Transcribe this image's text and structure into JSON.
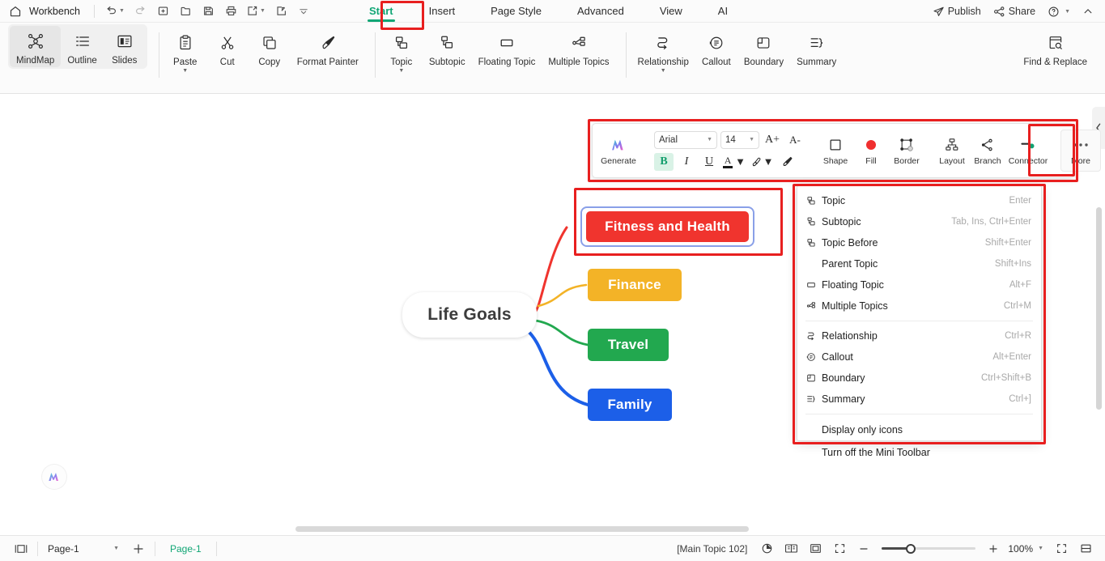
{
  "app": {
    "workbench_label": "Workbench",
    "accent_green": "#11a675",
    "annotation_red": "#e81f1f"
  },
  "quick_access": [
    {
      "name": "undo",
      "icon": "undo-icon",
      "caret": true
    },
    {
      "name": "redo",
      "icon": "redo-icon",
      "caret": false
    },
    {
      "name": "new",
      "icon": "new-file-icon",
      "caret": false
    },
    {
      "name": "open",
      "icon": "open-folder-icon",
      "caret": false
    },
    {
      "name": "save",
      "icon": "save-icon",
      "caret": false
    },
    {
      "name": "print",
      "icon": "print-icon",
      "caret": false
    },
    {
      "name": "export",
      "icon": "export-icon",
      "caret": true
    },
    {
      "name": "import",
      "icon": "import-icon",
      "caret": false
    },
    {
      "name": "customize",
      "icon": "chevron-down-icon",
      "caret": false
    }
  ],
  "tabs": [
    {
      "label": "Start",
      "active": true
    },
    {
      "label": "Insert",
      "active": false
    },
    {
      "label": "Page Style",
      "active": false
    },
    {
      "label": "Advanced",
      "active": false
    },
    {
      "label": "View",
      "active": false
    },
    {
      "label": "AI",
      "active": false
    }
  ],
  "topbar_right": [
    {
      "label": "Publish",
      "icon": "publish-send-icon"
    },
    {
      "label": "Share",
      "icon": "share-nodes-icon"
    },
    {
      "label": "",
      "icon": "help-circle-icon"
    },
    {
      "label": "",
      "icon": "collapse-ribbon-icon"
    }
  ],
  "ribbon": {
    "view_modes": [
      {
        "label": "MindMap",
        "icon": "mindmap-icon",
        "selected": true
      },
      {
        "label": "Outline",
        "icon": "outline-list-icon",
        "selected": false
      },
      {
        "label": "Slides",
        "icon": "slides-icon",
        "selected": false
      }
    ],
    "clipboard": [
      {
        "label": "Paste",
        "icon": "paste-icon",
        "caret": true
      },
      {
        "label": "Cut",
        "icon": "scissors-icon",
        "caret": false
      },
      {
        "label": "Copy",
        "icon": "copy-icon",
        "caret": false
      },
      {
        "label": "Format Painter",
        "icon": "format-painter-icon",
        "caret": false
      }
    ],
    "topics": [
      {
        "label": "Topic",
        "icon": "topic-icon",
        "caret": true
      },
      {
        "label": "Subtopic",
        "icon": "subtopic-icon",
        "caret": false
      },
      {
        "label": "Floating Topic",
        "icon": "floating-topic-icon",
        "caret": false
      },
      {
        "label": "Multiple Topics",
        "icon": "multiple-topics-icon",
        "caret": false
      }
    ],
    "annotations": [
      {
        "label": "Relationship",
        "icon": "relationship-icon",
        "caret": true
      },
      {
        "label": "Callout",
        "icon": "callout-icon",
        "caret": false
      },
      {
        "label": "Boundary",
        "icon": "boundary-icon",
        "caret": false
      },
      {
        "label": "Summary",
        "icon": "summary-icon",
        "caret": false
      }
    ],
    "find": {
      "label": "Find & Replace",
      "icon": "find-replace-icon"
    }
  },
  "mini_toolbar": {
    "generate": {
      "label": "Generate",
      "icon": "ai-generate-icon"
    },
    "font_family": "Arial",
    "font_size": "14",
    "increase_font": "A+",
    "decrease_font": "A-",
    "bold": "B",
    "italic": "I",
    "underline": "U",
    "font_color": "A",
    "highlight": "highlighter-icon",
    "clear_format": "clear-format-icon",
    "shape": {
      "label": "Shape",
      "icon": "shape-square-icon"
    },
    "fill": {
      "label": "Fill",
      "icon": "fill-circle-icon",
      "color": "#f02f2f"
    },
    "border": {
      "label": "Border",
      "icon": "border-icon"
    },
    "layout": {
      "label": "Layout",
      "icon": "layout-icon"
    },
    "branch": {
      "label": "Branch",
      "icon": "branch-icon"
    },
    "connector": {
      "label": "Connector",
      "icon": "connector-icon",
      "color": "#12a071"
    },
    "more": {
      "label": "More",
      "icon": "ellipsis-icon"
    }
  },
  "menu": {
    "items": [
      {
        "label": "Topic",
        "shortcut": "Enter",
        "icon": "topic-icon"
      },
      {
        "label": "Subtopic",
        "shortcut": "Tab, Ins, Ctrl+Enter",
        "icon": "subtopic-icon"
      },
      {
        "label": "Topic Before",
        "shortcut": "Shift+Enter",
        "icon": "topic-before-icon"
      },
      {
        "label": "Parent Topic",
        "shortcut": "Shift+Ins",
        "icon": ""
      },
      {
        "label": "Floating Topic",
        "shortcut": "Alt+F",
        "icon": "floating-topic-icon"
      },
      {
        "label": "Multiple Topics",
        "shortcut": "Ctrl+M",
        "icon": "multiple-topics-icon"
      }
    ],
    "items2": [
      {
        "label": "Relationship",
        "shortcut": "Ctrl+R",
        "icon": "relationship-icon"
      },
      {
        "label": "Callout",
        "shortcut": "Alt+Enter",
        "icon": "callout-icon"
      },
      {
        "label": "Boundary",
        "shortcut": "Ctrl+Shift+B",
        "icon": "boundary-icon"
      },
      {
        "label": "Summary",
        "shortcut": "Ctrl+]",
        "icon": "summary-icon"
      }
    ],
    "items3": [
      {
        "label": "Display only icons",
        "shortcut": "",
        "icon": ""
      },
      {
        "label": "Turn off the Mini Toolbar",
        "shortcut": "",
        "icon": ""
      }
    ]
  },
  "mindmap": {
    "root": {
      "label": "Life Goals",
      "color": "#ffffff",
      "text_color": "#3c3c3c"
    },
    "branches": [
      {
        "label": "Fitness and Health",
        "color": "#f0342e",
        "selected": true
      },
      {
        "label": "Finance",
        "color": "#f3b327",
        "selected": false
      },
      {
        "label": "Travel",
        "color": "#22a84f",
        "selected": false
      },
      {
        "label": "Family",
        "color": "#1c5fe8",
        "selected": false
      }
    ]
  },
  "statusbar": {
    "page_select": "Page-1",
    "add_page": "+",
    "page_tab": "Page-1",
    "topic_status": "[Main Topic 102]",
    "zoom_percent": "100%",
    "buttons": [
      {
        "name": "sidebar-toggle-icon"
      },
      {
        "name": "mouse-mode-icon"
      },
      {
        "name": "book-view-icon"
      },
      {
        "name": "fit-map-icon"
      },
      {
        "name": "fullscreen-icon"
      },
      {
        "name": "presentation-icon"
      },
      {
        "name": "split-view-icon"
      }
    ]
  }
}
